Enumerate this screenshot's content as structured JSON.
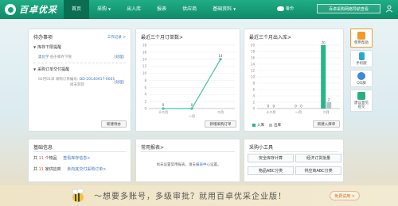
{
  "brand": {
    "name": "百卓优采"
  },
  "nav": [
    {
      "label": "首页",
      "active": true,
      "dropdown": false
    },
    {
      "label": "采购",
      "active": false,
      "dropdown": true
    },
    {
      "label": "出入库",
      "active": false,
      "dropdown": false
    },
    {
      "label": "报表",
      "active": false,
      "dropdown": false
    },
    {
      "label": "供应商",
      "active": false,
      "dropdown": false
    },
    {
      "label": "基础资料",
      "active": false,
      "dropdown": true
    }
  ],
  "header": {
    "cloud_label": "备份",
    "top_button": "百卓采购网络导航查看"
  },
  "todo": {
    "title": "待办事项",
    "link": "工作记录 >",
    "section1": "库存下限提醒",
    "row1_item": "奥化学",
    "row1_text": "低于库存下限",
    "process": "[处理]",
    "section2": "采购订单交付提醒",
    "row2_date": "02月01日",
    "row2_text": "采购订单编号:",
    "row2_code": "DD-20140917-0001",
    "row2_status": "尚未到货",
    "row2_process": "[处理]",
    "button": "新建待办"
  },
  "orders_panel": {
    "title": "最近三个月订单数>",
    "button": "新增采购订单"
  },
  "stock_panel": {
    "title": "最近三个月出入库>",
    "button": "新建入库单",
    "legend_in": "入库",
    "legend_out": "出库"
  },
  "chart_data": [
    {
      "type": "line",
      "categories": [
        "十二月",
        "一月",
        "二月"
      ],
      "values": [
        0,
        0,
        14
      ],
      "title": "",
      "xlabel": "",
      "ylabel": "",
      "ylim": [
        0,
        18
      ],
      "yticks": [
        0,
        2,
        4,
        6,
        8,
        10,
        12,
        14,
        16,
        18
      ],
      "grid": true,
      "color": "#3ec6a0"
    },
    {
      "type": "bar",
      "categories": [
        "十二月",
        "一月",
        "二月"
      ],
      "series": [
        {
          "name": "入库",
          "values": [
            0,
            0,
            20
          ],
          "color": "#27b686"
        },
        {
          "name": "出库",
          "values": [
            0,
            0,
            2
          ],
          "color": "#b5c0c8"
        }
      ],
      "ylim": [
        0,
        20
      ],
      "yticks": [
        0,
        2,
        4,
        6,
        8,
        10,
        12,
        14,
        16,
        18,
        20
      ],
      "grid": true,
      "legend": "bottom"
    }
  ],
  "sidebar": [
    {
      "label": "使用帮助",
      "icon": "help-icon",
      "color": "#f39a2b",
      "active": true
    },
    {
      "label": "手机版",
      "icon": "mobile-icon",
      "color": "#2aa7d4",
      "active": false
    },
    {
      "label": "QQ群",
      "icon": "qq-icon",
      "color": "#3a8ad6",
      "active": false
    },
    {
      "label": "建议意见提交",
      "icon": "feedback-icon",
      "color": "#29b07e",
      "active": false
    }
  ],
  "basic": {
    "title": "基础信息",
    "row1_prefix": "共",
    "row1_count": "11",
    "row1_unit": "个物品",
    "row1_link": "查看库存信息>",
    "row2_prefix": "共",
    "row2_count": "11",
    "row2_unit": "家供应商",
    "row2_link": "未向其交付采购订单>"
  },
  "reports": {
    "title": "常用报表>",
    "text": "尚未设置常用报表，请去",
    "link": "报表中心",
    "text2": "设置。"
  },
  "tools": {
    "title": "采购小工具",
    "items": [
      "安全库存计算",
      "经济订货批量",
      "物品ABC分类",
      "供应商ABC分类"
    ]
  },
  "banner": {
    "text": "～想要多账号，多级审批？就用百卓优采企业版！",
    "button": "免费试用 >"
  }
}
